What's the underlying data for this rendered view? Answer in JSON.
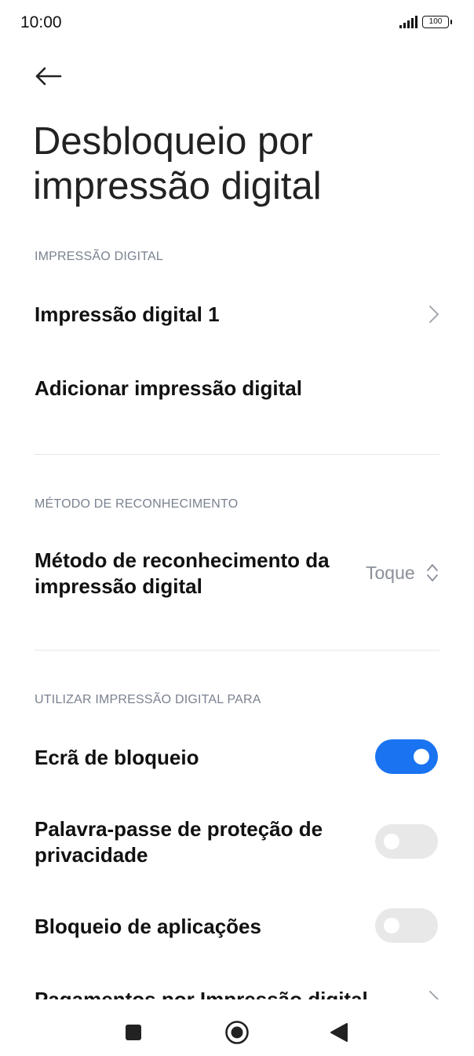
{
  "status_bar": {
    "time": "10:00",
    "battery": "100",
    "icons": [
      "signal-icon",
      "battery-icon"
    ]
  },
  "header": {
    "back_icon": "arrow-left-icon",
    "title": "Desbloqueio por impressão digital"
  },
  "sections": {
    "fingerprint": {
      "header": "IMPRESSÃO DIGITAL",
      "item1": "Impressão digital 1",
      "add": "Adicionar impressão digital"
    },
    "recognition": {
      "header": "MÉTODO DE RECONHECIMENTO",
      "method_label": "Método de reconhecimento da impressão digital",
      "method_value": "Toque"
    },
    "use_for": {
      "header": "UTILIZAR IMPRESSÃO DIGITAL PARA",
      "lock_screen": "Ecrã de bloqueio",
      "lock_screen_enabled": true,
      "privacy_password": "Palavra-passe de proteção de privacidade",
      "privacy_password_enabled": false,
      "app_lock": "Bloqueio de aplicações",
      "app_lock_enabled": false,
      "payments": "Pagamentos por Impressão digital"
    }
  },
  "colors": {
    "accent": "#1a73f0",
    "toggle_off": "#e8e8e8",
    "section_header": "#7a8290"
  },
  "nav": {
    "icons": [
      "recents-square-icon",
      "home-circle-icon",
      "back-triangle-icon"
    ]
  }
}
